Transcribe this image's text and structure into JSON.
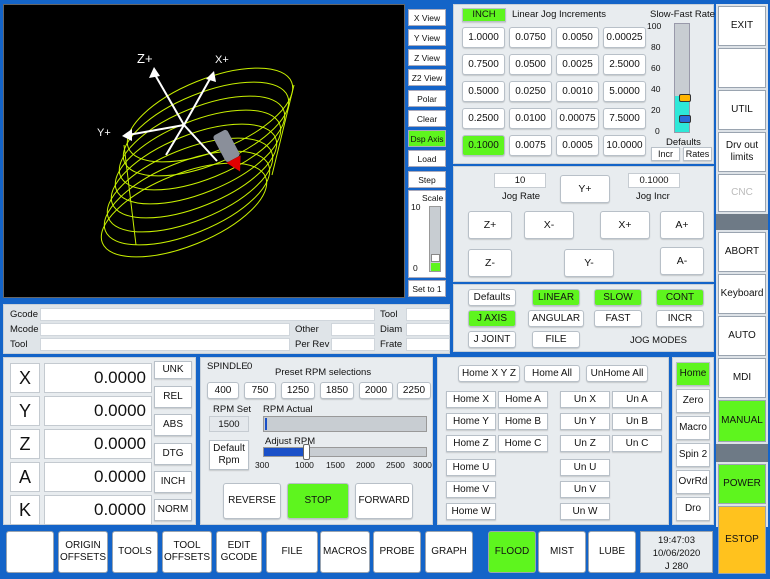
{
  "viewport": {
    "axis_z": "Z+",
    "axis_x": "X+",
    "axis_y": "Y+",
    "buttons": [
      "X View",
      "Y View",
      "Z View",
      "Z2 View",
      "Polar",
      "Clear",
      "Dsp Axis",
      "Load",
      "Step"
    ],
    "scale_label": "Scale",
    "scale_max": "10",
    "scale_min": "0",
    "set_button": "Set to 1"
  },
  "info": {
    "gcode": "Gcode",
    "mcode": "Mcode",
    "tool": "Tool",
    "other": "Other",
    "per_rev": "Per Rev",
    "tool2": "Tool",
    "diam": "Diam",
    "frate": "Frate"
  },
  "jog_increments": {
    "units": "INCH",
    "title": "Linear Jog Increments",
    "values": [
      [
        "1.0000",
        "0.0750",
        "0.0050",
        "0.00025"
      ],
      [
        "0.7500",
        "0.0500",
        "0.0025",
        "2.5000"
      ],
      [
        "0.5000",
        "0.0250",
        "0.0010",
        "5.0000"
      ],
      [
        "0.2500",
        "0.0100",
        "0.00075",
        "7.5000"
      ],
      [
        "0.1000",
        "0.0075",
        "0.0005",
        "10.0000"
      ]
    ]
  },
  "rate_slider": {
    "title": "Slow-Fast Rate",
    "ticks": [
      "100",
      "80",
      "60",
      "40",
      "20",
      "0"
    ],
    "defaults": "Defaults",
    "incr": "Incr",
    "rates": "Rates"
  },
  "jog": {
    "jog_rate_value": "10",
    "jog_rate_label": "Jog Rate",
    "jog_incr_value": "0.1000",
    "jog_incr_label": "Jog Incr",
    "y_plus": "Y+",
    "y_minus": "Y-",
    "z_plus": "Z+",
    "z_minus": "Z-",
    "x_minus": "X-",
    "x_plus": "X+",
    "a_plus": "A+",
    "a_minus": "A-"
  },
  "jog_modes": {
    "defaults": "Defaults",
    "linear": "LINEAR",
    "slow": "SLOW",
    "cont": "CONT",
    "j_axis": "J AXIS",
    "angular": "ANGULAR",
    "fast": "FAST",
    "incr": "INCR",
    "j_joint": "J JOINT",
    "file": "FILE",
    "label": "JOG MODES"
  },
  "dro": {
    "axes": [
      {
        "letter": "X",
        "value": "0.0000"
      },
      {
        "letter": "Y",
        "value": "0.0000"
      },
      {
        "letter": "Z",
        "value": "0.0000"
      },
      {
        "letter": "A",
        "value": "0.0000"
      },
      {
        "letter": "K",
        "value": "0.0000"
      }
    ],
    "modes": [
      "UNK",
      "REL",
      "ABS",
      "DTG",
      "INCH",
      "NORM"
    ]
  },
  "spindle": {
    "title": "SPINDLE",
    "speed": "0",
    "preset_title": "Preset RPM selections",
    "presets": [
      "400",
      "750",
      "1250",
      "1850",
      "2000",
      "2250"
    ],
    "rpm_set_label": "RPM Set",
    "rpm_set_value": "1500",
    "rpm_actual_label": "RPM Actual",
    "adjust_label": "Adjust RPM",
    "adjust_level": 0.26,
    "adjust_ticks": [
      "300",
      "1000",
      "1500",
      "2000",
      "2500",
      "3000"
    ],
    "default_rpm": "Default Rpm",
    "reverse": "REVERSE",
    "stop": "STOP",
    "forward": "FORWARD"
  },
  "homing": {
    "home_xyz": "Home X Y Z",
    "home_all": "Home All",
    "unhome_all": "UnHome All",
    "home_x": "Home X",
    "home_a": "Home A",
    "un_x": "Un X",
    "un_a": "Un A",
    "home_y": "Home Y",
    "home_b": "Home B",
    "un_y": "Un Y",
    "un_b": "Un B",
    "home_z": "Home Z",
    "home_c": "Home C",
    "un_z": "Un Z",
    "un_c": "Un C",
    "home_u": "Home U",
    "un_u": "Un U",
    "home_v": "Home V",
    "un_v": "Un V",
    "home_w": "Home W",
    "un_w": "Un W"
  },
  "side_tabs": [
    "Home",
    "Zero",
    "Macro",
    "Spin 2",
    "OvrRd",
    "Dro"
  ],
  "right_menu": {
    "exit": "EXIT",
    "util": "UTIL",
    "drv": "Drv out limits",
    "cnc": "CNC",
    "abort": "ABORT",
    "keyboard": "Keyboard",
    "auto": "AUTO",
    "mdi": "MDI",
    "manual": "MANUAL",
    "power": "POWER",
    "estop": "ESTOP"
  },
  "toolbar": {
    "origin": "ORIGIN OFFSETS",
    "tools": "TOOLS",
    "tool_offsets": "TOOL OFFSETS",
    "edit": "EDIT GCODE",
    "file": "FILE",
    "macros": "MACROS",
    "probe": "PROBE",
    "graph": "GRAPH",
    "flood": "FLOOD",
    "mist": "MIST",
    "lube": "LUBE"
  },
  "status": {
    "time": "19:47:03",
    "date": "10/06/2020",
    "job": "J 280"
  },
  "colors": {
    "active": "#5ef51e",
    "estop": "#ffc21e",
    "frame": "#1464c8"
  }
}
